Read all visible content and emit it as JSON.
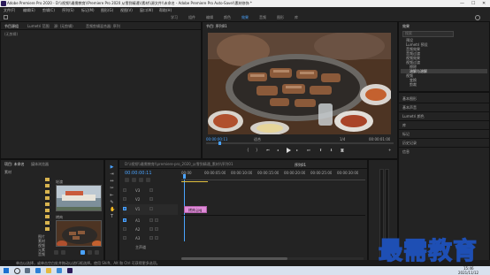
{
  "titlebar": {
    "title": "Adobe Premiere Pro 2020 - D:\\\\视频\\\\最需教育\\\\Premiere Pro 2020 从零到精通\\\\素材\\\\源文件\\\\未命名 - Adobe Premiere Pro Auto-Save\\\\素材修饰 *",
    "min": "—",
    "max": "☐",
    "close": "✕"
  },
  "menu": [
    "文件(F)",
    "编辑(E)",
    "剪辑(C)",
    "序列(S)",
    "标记(M)",
    "图形(G)",
    "视图(V)",
    "窗口(W)",
    "帮助(H)"
  ],
  "workspaces": [
    "学习",
    "组件",
    "编辑",
    "颜色",
    "效果",
    "音频",
    "图形",
    "库"
  ],
  "workspace_active": "效果",
  "source_panel": {
    "tabs": [
      "节目源组",
      "Lumetri 范围",
      "源: (无剪辑)",
      "音频剪辑混合器: 序列"
    ],
    "sub": "(无剪辑)"
  },
  "program_panel": {
    "tab": "节目: 序列01",
    "timecode_left": "00:00:00:11",
    "fit": "适合",
    "ratio": "1/4",
    "timecode_right": "00:00:01:00"
  },
  "effects_panel": {
    "tab": "效果",
    "search_placeholder": "搜索",
    "tree": [
      "预设",
      "Lumetri 预设",
      "音频效果",
      "音频过渡",
      "视频效果",
      "视频过渡",
      "擦除",
      "溶解与溶解",
      "视频",
      "变换",
      "剪裁",
      "裁剪运动"
    ]
  },
  "right_list": [
    "基本图形",
    "基本声音",
    "Lumetri 颜色",
    "库",
    "标记",
    "历史记录",
    "信息"
  ],
  "project_panel": {
    "tabs": [
      "项目: 未命名",
      "媒体浏览器"
    ],
    "path": "素材",
    "items": [
      "图片",
      "素材",
      "视频",
      "元素",
      "音频",
      "图片1",
      "图片2",
      "素材1",
      "素材2"
    ],
    "clip1_label": "轮渡",
    "clip2_label": "烤肉"
  },
  "tools": [
    "▶",
    "⇥",
    "↔",
    "✂",
    "⇤",
    "✎",
    "✋",
    "T"
  ],
  "timeline": {
    "tab": "序列01",
    "header_path": "D:\\\\视频\\\\最需教育\\\\premiere-pro_2020_从零到精通_素材\\\\序列01",
    "timecode": "00:00:00:11",
    "ruler": [
      "00:00",
      "00:00:05:00",
      "00:00:10:00",
      "00:00:15:00",
      "00:00:20:00",
      "00:00:25:00",
      "00:00:30:00"
    ],
    "tracks": [
      "V3",
      "V2",
      "V1",
      "A1",
      "A2",
      "A3",
      "主声道"
    ],
    "clip_label": "烤肉.jpg"
  },
  "statusbar": {
    "text": "单击以选择，或单击空白处并拖动以进行框选择。使用 Shift、Alt 和 Ctrl 可获得更多选项。"
  },
  "taskbar": {
    "time": "15:46",
    "date": "2021/11/12"
  },
  "watermark": "最需教育"
}
